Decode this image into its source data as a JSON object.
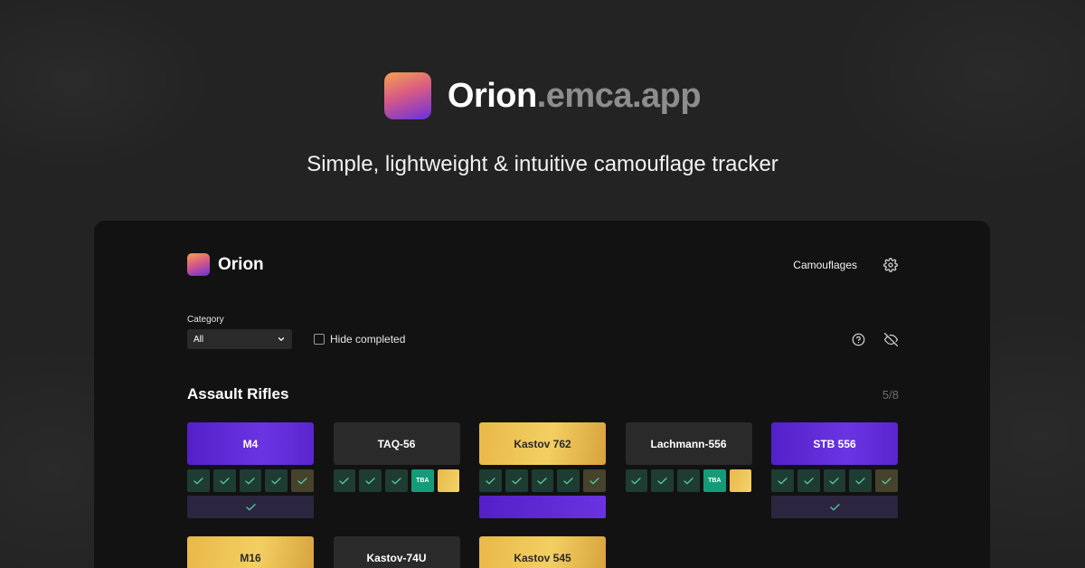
{
  "hero": {
    "brand_main": "Orion",
    "brand_domain": ".emca.app",
    "tagline": "Simple, lightweight & intuitive camouflage tracker"
  },
  "app": {
    "name": "Orion",
    "nav_camouflages": "Camouflages",
    "category_label": "Category",
    "category_value": "All",
    "hide_completed_label": "Hide completed"
  },
  "section": {
    "title": "Assault Rifles",
    "count": "5/8"
  },
  "chip_tba": "TBA",
  "colors": {
    "accent_purple": "#5f2ad6",
    "accent_gold": "#f0c656",
    "done_green": "#1e3c32",
    "tba_green": "#149c78",
    "window_bg": "#121212",
    "page_bg": "#232323"
  },
  "weapons": [
    {
      "name": "M4",
      "style": "purple",
      "chips": [
        "done",
        "done",
        "done",
        "done",
        "olive"
      ],
      "bar": "dark-check"
    },
    {
      "name": "TAQ-56",
      "style": "gray",
      "chips": [
        "done",
        "done",
        "done",
        "tba",
        "gold"
      ],
      "bar": "none"
    },
    {
      "name": "Kastov 762",
      "style": "gold",
      "chips": [
        "done",
        "done",
        "done",
        "done",
        "olive"
      ],
      "bar": "purple"
    },
    {
      "name": "Lachmann-556",
      "style": "gray",
      "chips": [
        "done",
        "done",
        "done",
        "tba",
        "gold"
      ],
      "bar": "none"
    },
    {
      "name": "STB 556",
      "style": "purple",
      "chips": [
        "done",
        "done",
        "done",
        "done",
        "olive"
      ],
      "bar": "dark-check"
    },
    {
      "name": "M16",
      "style": "gold",
      "chips": [],
      "bar": "none"
    },
    {
      "name": "Kastov-74U",
      "style": "gray",
      "chips": [],
      "bar": "none"
    },
    {
      "name": "Kastov 545",
      "style": "gold",
      "chips": [],
      "bar": "none"
    }
  ],
  "icons": {
    "logo": "orion-logo-icon",
    "settings": "gear-icon",
    "help": "help-circle-icon",
    "hide_visibility": "eye-off-icon",
    "select_arrow": "chevron-down-icon",
    "tick": "check-icon"
  }
}
